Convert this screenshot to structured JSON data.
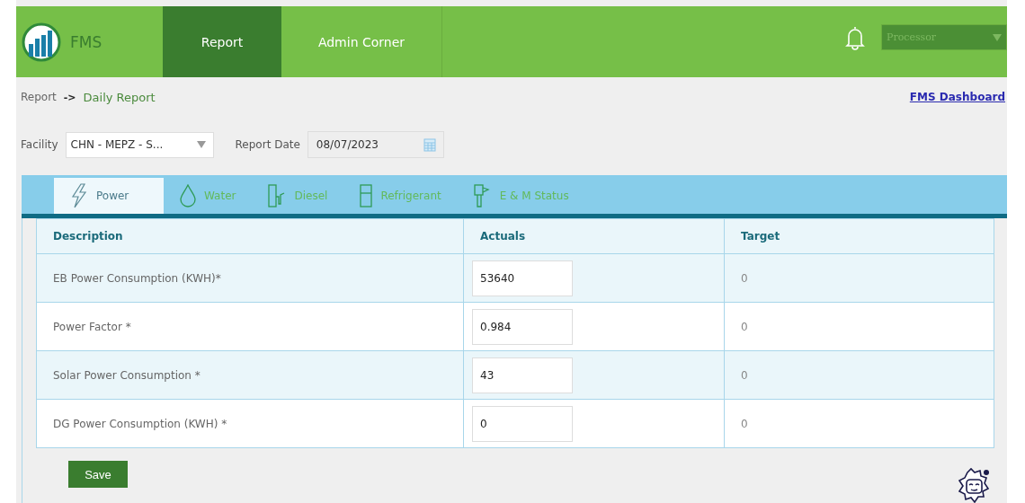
{
  "header": {
    "logo_text": "FMS",
    "nav": [
      {
        "label": "Report",
        "selected": true
      },
      {
        "label": "Admin Corner",
        "selected": false
      }
    ],
    "role_select": {
      "value": "Processor"
    }
  },
  "breadcrumb": {
    "parent": "Report",
    "separator": "->",
    "current": "Daily Report"
  },
  "dashboard_link": "FMS Dashboard",
  "filters": {
    "facility": {
      "label": "Facility",
      "value": "CHN - MEPZ - S..."
    },
    "report_date": {
      "label": "Report Date",
      "value": "08/07/2023"
    }
  },
  "tabs": [
    {
      "label": "Power",
      "kind": "power",
      "selected": true
    },
    {
      "label": "Water",
      "kind": "water",
      "selected": false
    },
    {
      "label": "Diesel",
      "kind": "diesel",
      "selected": false
    },
    {
      "label": "Refrigerant",
      "kind": "refrigerant",
      "selected": false
    },
    {
      "label": "E & M Status",
      "kind": "status",
      "selected": false
    }
  ],
  "table": {
    "columns": [
      "Description",
      "Actuals",
      "Target"
    ],
    "rows": [
      {
        "description": "EB Power Consumption (KWH)*",
        "actual": "53640",
        "target": "0"
      },
      {
        "description": "Power Factor *",
        "actual": "0.984",
        "target": "0"
      },
      {
        "description": "Solar Power Consumption *",
        "actual": "43",
        "target": "0"
      },
      {
        "description": "DG Power Consumption (KWH) *",
        "actual": "0",
        "target": "0"
      }
    ]
  },
  "save_button": "Save"
}
